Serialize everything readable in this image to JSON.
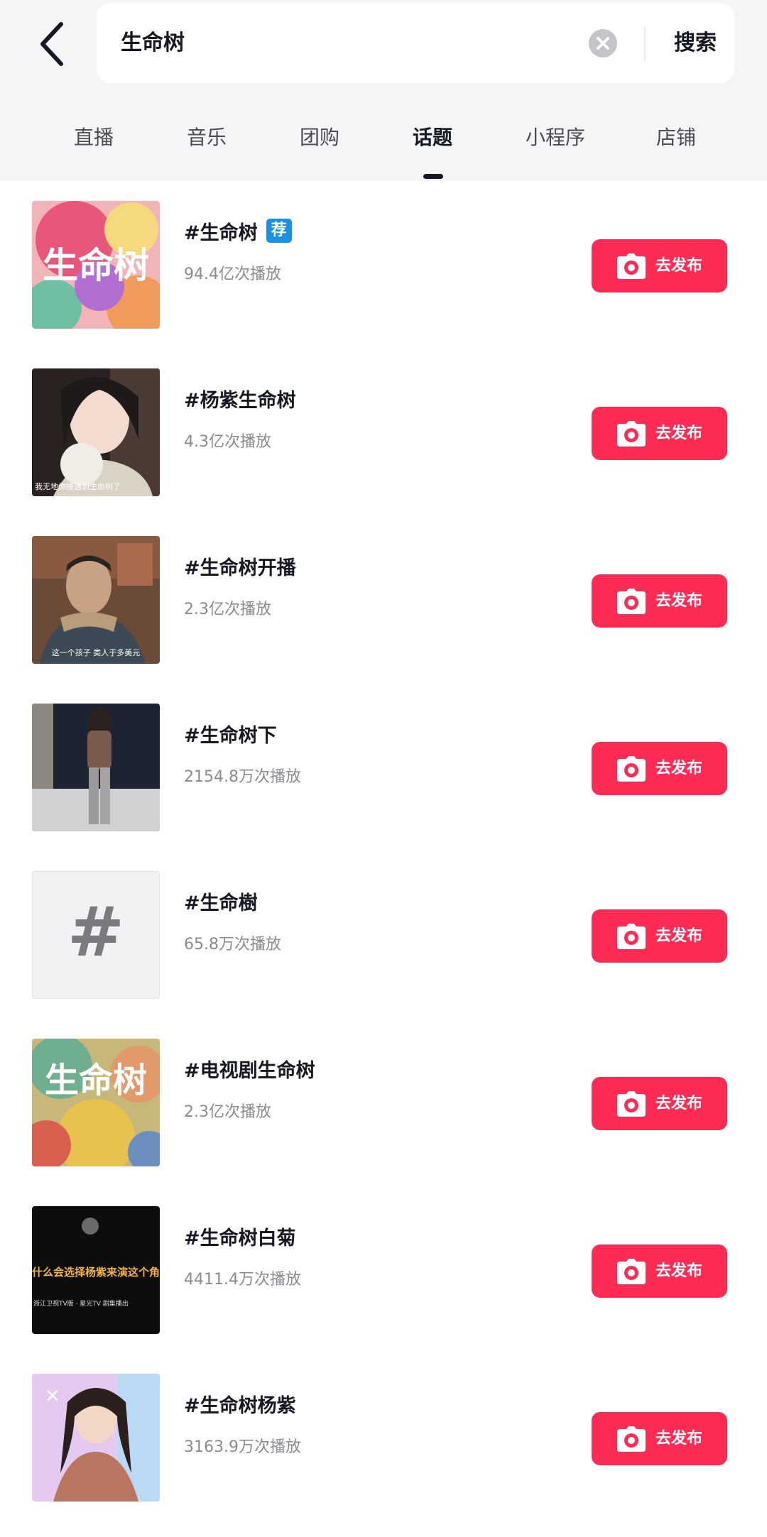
{
  "search": {
    "query": "生命树",
    "button_label": "搜索"
  },
  "tabs": [
    {
      "label": "直播",
      "active": false
    },
    {
      "label": "音乐",
      "active": false
    },
    {
      "label": "团购",
      "active": false
    },
    {
      "label": "话题",
      "active": true
    },
    {
      "label": "小程序",
      "active": false
    },
    {
      "label": "店铺",
      "active": false
    }
  ],
  "topics": [
    {
      "title": "#生命树",
      "badge": "荐",
      "plays": "94.4亿次播放",
      "thumb_text": "生命树",
      "publish_label": "去发布"
    },
    {
      "title": "#杨紫生命树",
      "plays": "4.3亿次播放",
      "thumb_caption": "我无地你接遇到生命树了",
      "publish_label": "去发布"
    },
    {
      "title": "#生命树开播",
      "plays": "2.3亿次播放",
      "thumb_caption": "这一个孩子 类人于多美元",
      "publish_label": "去发布"
    },
    {
      "title": "#生命树下",
      "plays": "2154.8万次播放",
      "publish_label": "去发布"
    },
    {
      "title": "#生命樹",
      "plays": "65.8万次播放",
      "thumb_text": "#",
      "publish_label": "去发布"
    },
    {
      "title": "#电视剧生命树",
      "plays": "2.3亿次播放",
      "thumb_text": "生命树",
      "publish_label": "去发布"
    },
    {
      "title": "#生命树白菊",
      "plays": "4411.4万次播放",
      "thumb_caption": "什么会选择杨紫来演这个角色",
      "thumb_caption2": "浙江卫视TV版 · 星光TV 剧集播出",
      "publish_label": "去发布"
    },
    {
      "title": "#生命树杨紫",
      "plays": "3163.9万次播放",
      "publish_label": "去发布"
    }
  ],
  "colors": {
    "accent": "#fe2c55",
    "badge": "#1a8fe8",
    "header_bg": "#f4f5f7"
  },
  "icons": {
    "back": "chevron-left-icon",
    "clear": "close-circle-icon",
    "publish": "camera-icon"
  }
}
